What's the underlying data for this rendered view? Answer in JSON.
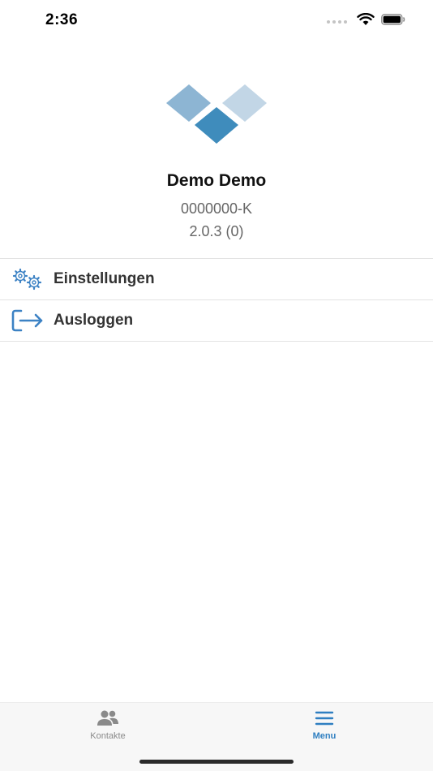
{
  "status_bar": {
    "time": "2:36",
    "icons": [
      "signal-dots",
      "wifi-icon",
      "battery-icon"
    ]
  },
  "profile": {
    "name": "Demo Demo",
    "id": "0000000-K",
    "version": "2.0.3 (0)",
    "logo_colors": [
      "#8db5d3",
      "#c2d6e6",
      "#3f8cbc"
    ]
  },
  "menu": {
    "items": [
      {
        "label": "Einstellungen",
        "icon": "gears-icon"
      },
      {
        "label": "Ausloggen",
        "icon": "logout-icon"
      }
    ]
  },
  "tab_bar": {
    "tabs": [
      {
        "label": "Kontakte",
        "icon": "users-icon",
        "active": false
      },
      {
        "label": "Menu",
        "icon": "hamburger-icon",
        "active": true
      }
    ]
  },
  "colors": {
    "accent": "#2f7fc1",
    "icon_blue": "#3c82c4",
    "inactive": "#8a8a8a"
  }
}
